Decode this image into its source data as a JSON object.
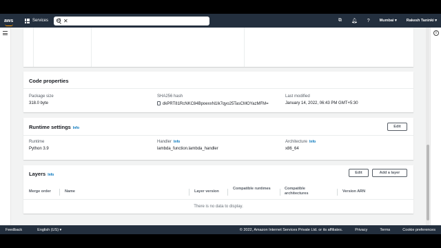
{
  "header": {
    "logo": "aws",
    "services_label": "Services",
    "search_value": "s3",
    "region": "Mumbai",
    "user": "Rakesh Taninki"
  },
  "code_properties": {
    "title": "Code properties",
    "package_size_label": "Package size",
    "package_size_value": "318.0 byte",
    "sha_label": "SHA256 hash",
    "sha_value": "dkPRT81RcNKC84BpoexxN1lk7qyo25TasCMOYazMFM=",
    "last_modified_label": "Last modified",
    "last_modified_value": "January 14, 2022, 06:43 PM GMT+5:30"
  },
  "runtime_settings": {
    "title": "Runtime settings",
    "info": "Info",
    "edit_label": "Edit",
    "runtime_label": "Runtime",
    "runtime_value": "Python 3.9",
    "handler_label": "Handler",
    "handler_info": "Info",
    "handler_value": "lambda_function.lambda_handler",
    "arch_label": "Architecture",
    "arch_info": "Info",
    "arch_value": "x86_64"
  },
  "layers": {
    "title": "Layers",
    "info": "Info",
    "edit_label": "Edit",
    "add_label": "Add a layer",
    "columns": [
      "Merge order",
      "Name",
      "Layer version",
      "Compatible runtimes",
      "Compatible architectures",
      "Version ARN"
    ],
    "empty_text": "There is no data to display."
  },
  "footer": {
    "feedback": "Feedback",
    "language": "English (US)",
    "copyright": "© 2022, Amazon Internet Services Private Ltd. or its affiliates.",
    "privacy": "Privacy",
    "terms": "Terms",
    "cookies": "Cookie preferences"
  }
}
